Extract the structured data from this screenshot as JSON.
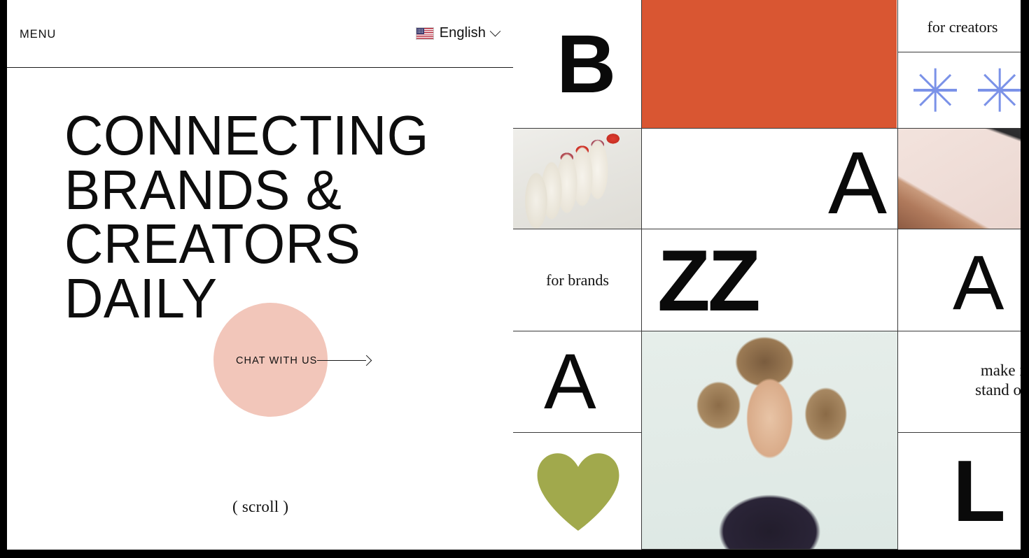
{
  "header": {
    "menu_label": "MENU",
    "language": {
      "flag_icon": "us-flag-icon",
      "label": "English",
      "chevron_icon": "chevron-down-icon"
    }
  },
  "hero": {
    "headline": "CONNECTING\nBRANDS &\nCREATORS\nDAILY",
    "chat_cta": {
      "label": "CHAT WITH US",
      "arrow_icon": "arrow-right-icon",
      "circle_color": "#f2c6ba"
    },
    "scroll_hint": "( scroll )"
  },
  "grid": {
    "cells": [
      {
        "id": "cell-letter-b",
        "kind": "letter",
        "value": "B"
      },
      {
        "id": "cell-orange-block",
        "kind": "color",
        "value": "#d95632"
      },
      {
        "id": "cell-for-creators",
        "kind": "serif",
        "value": "for creators"
      },
      {
        "id": "cell-blank-tr",
        "kind": "blank",
        "value": ""
      },
      {
        "id": "cell-asterisks",
        "kind": "icons",
        "value": "asterisk-icon",
        "count": 4,
        "color": "#7b92e8"
      },
      {
        "id": "cell-photo-lipsticks",
        "kind": "photo",
        "value": "lipstick-tubes-photo"
      },
      {
        "id": "cell-letter-a-top",
        "kind": "letter",
        "value": "A"
      },
      {
        "id": "cell-photo-phone",
        "kind": "photo",
        "value": "hands-holding-phone-photo"
      },
      {
        "id": "cell-for-brands",
        "kind": "serif",
        "value": "for brands"
      },
      {
        "id": "cell-letters-zz",
        "kind": "letter",
        "value": "ZZ"
      },
      {
        "id": "cell-letter-a-right",
        "kind": "letter",
        "value": "A"
      },
      {
        "id": "cell-letter-a-left",
        "kind": "letter",
        "value": "A"
      },
      {
        "id": "cell-photo-model",
        "kind": "photo",
        "value": "model-portrait-photo"
      },
      {
        "id": "cell-make-it-stand-out",
        "kind": "serif",
        "value": "make it\nstand out"
      },
      {
        "id": "cell-heart",
        "kind": "icon",
        "value": "heart-icon",
        "color": "#a1a94c"
      },
      {
        "id": "cell-letter-l",
        "kind": "letter",
        "value": "L"
      }
    ],
    "letter_b": "B",
    "for_creators": "for creators",
    "letter_a_top": "A",
    "for_brands": "for brands",
    "letters_zz": "ZZ",
    "letter_a_right": "A",
    "letter_a_left": "A",
    "make_it_stand_out": "make it\nstand out",
    "letter_l": "L"
  },
  "colors": {
    "orange": "#d95632",
    "pink": "#f2c6ba",
    "periwinkle": "#7b92e8",
    "olive": "#a1a94c",
    "ink": "#0d0d0d"
  }
}
